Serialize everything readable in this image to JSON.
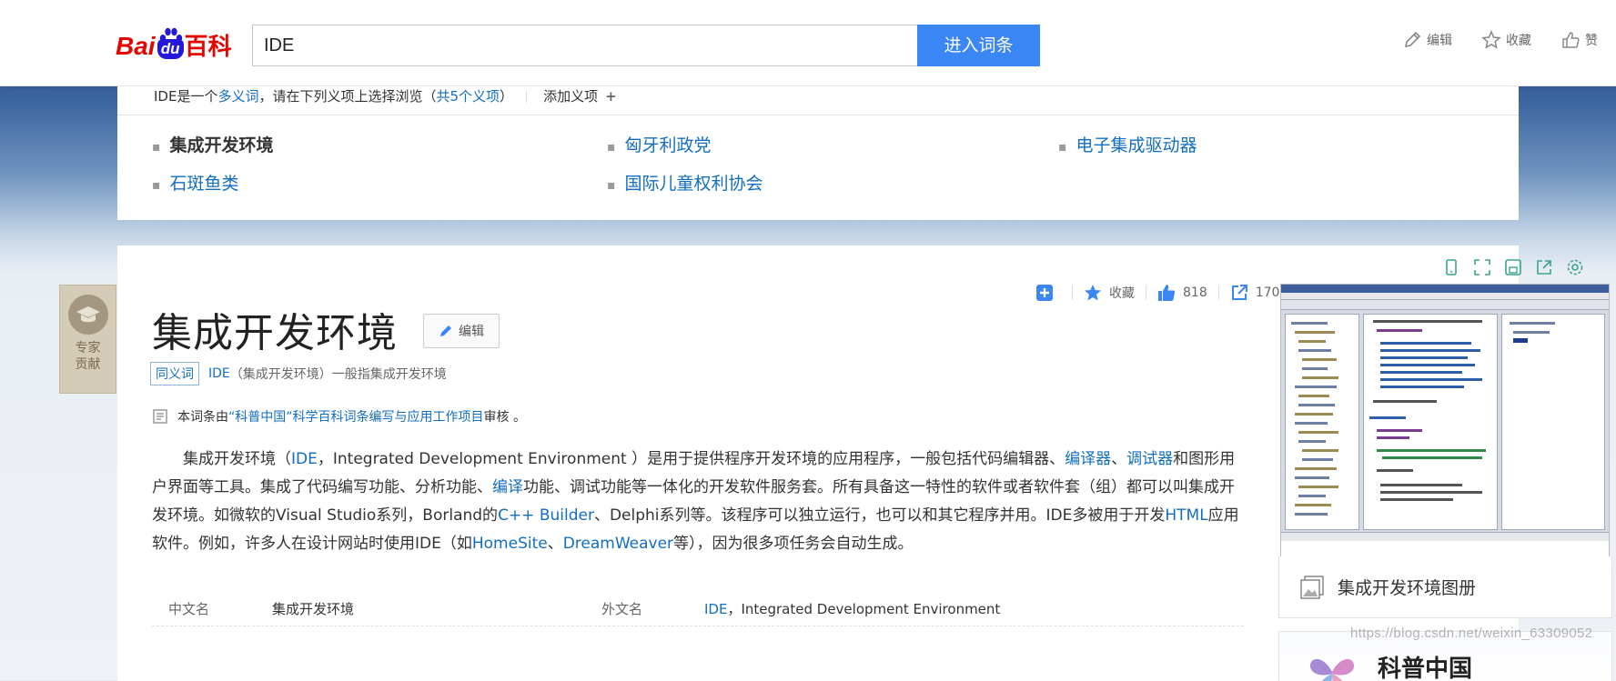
{
  "header": {
    "logo": {
      "bai": "Bai",
      "du": "du",
      "baike": "百科"
    },
    "search": {
      "value": "IDE"
    },
    "search_button": "进入词条",
    "actions": [
      {
        "label": "编辑",
        "icon": "pencil-icon"
      },
      {
        "label": "收藏",
        "icon": "star-icon"
      },
      {
        "label": "赞",
        "icon": "thumbs-up-icon"
      }
    ]
  },
  "polysemy": {
    "intro_term": "IDE",
    "intro_pre": "是一个",
    "intro_link": "多义词",
    "intro_mid": "，请在下列义项上选择浏览（",
    "intro_count": "共5个义项",
    "intro_post": "）",
    "add_label": "添加义项",
    "add_plus": "+",
    "items": [
      {
        "label": "集成开发环境",
        "current": true
      },
      {
        "label": "匈牙利政党",
        "current": false
      },
      {
        "label": "电子集成驱动器",
        "current": false
      },
      {
        "label": "石斑鱼类",
        "current": false
      },
      {
        "label": "国际儿童权利协会",
        "current": false
      }
    ]
  },
  "expert": {
    "line1": "专家",
    "line2": "贡献"
  },
  "stats": {
    "favorite_label": "收藏",
    "likes": "818",
    "shares": "170"
  },
  "entry": {
    "title": "集成开发环境",
    "edit_label": "编辑",
    "synonym_tag": "同义词",
    "synonym_text_link": "IDE",
    "synonym_text": "（集成开发环境）一般指集成开发环境",
    "review_pre": "本词条由",
    "review_link": "“科普中国”科学百科词条编写与应用工作项目",
    "review_post": " 审核 。",
    "summary": {
      "s1": "集成开发环境（",
      "l1": "IDE",
      "s2": "，Integrated Development Environment ）是用于提供程序开发环境的应用程序，一般包括代码编辑器、",
      "l2": "编译器",
      "s3": "、",
      "l3": "调试器",
      "s4": "和图形用户界面等工具。集成了代码编写功能、分析功能、",
      "l4": "编译",
      "s5": "功能、调试功能等一体化的开发软件服务套。所有具备这一特性的软件或者软件套（组）都可以叫集成开发环境。如微软的Visual Studio系列，Borland的",
      "l5": "C++ Builder",
      "s6": "、Delphi系列等。该程序可以独立运行，也可以和其它程序并用。IDE多被用于开发",
      "l6": "HTML",
      "s7": "应用软件。例如，许多人在设计网站时使用IDE（如",
      "l7": "HomeSite",
      "s8": "、",
      "l8": "DreamWeaver",
      "s9": "等），因为很多项任务会自动生成。"
    },
    "basic_info": {
      "k1": "中文名",
      "v1": "集成开发环境",
      "k2": "外文名",
      "v2_link": "IDE",
      "v2_rest": "，Integrated Development Environment"
    }
  },
  "album": {
    "caption": "集成开发环境图册"
  },
  "kepu": {
    "title": "科普中国"
  },
  "watermark": "https://blog.csdn.net/weixin_63309052",
  "colors": {
    "accent": "#3b86f5",
    "link": "#136ec2",
    "brand_red": "#e10602",
    "brand_blue": "#2319dc"
  }
}
